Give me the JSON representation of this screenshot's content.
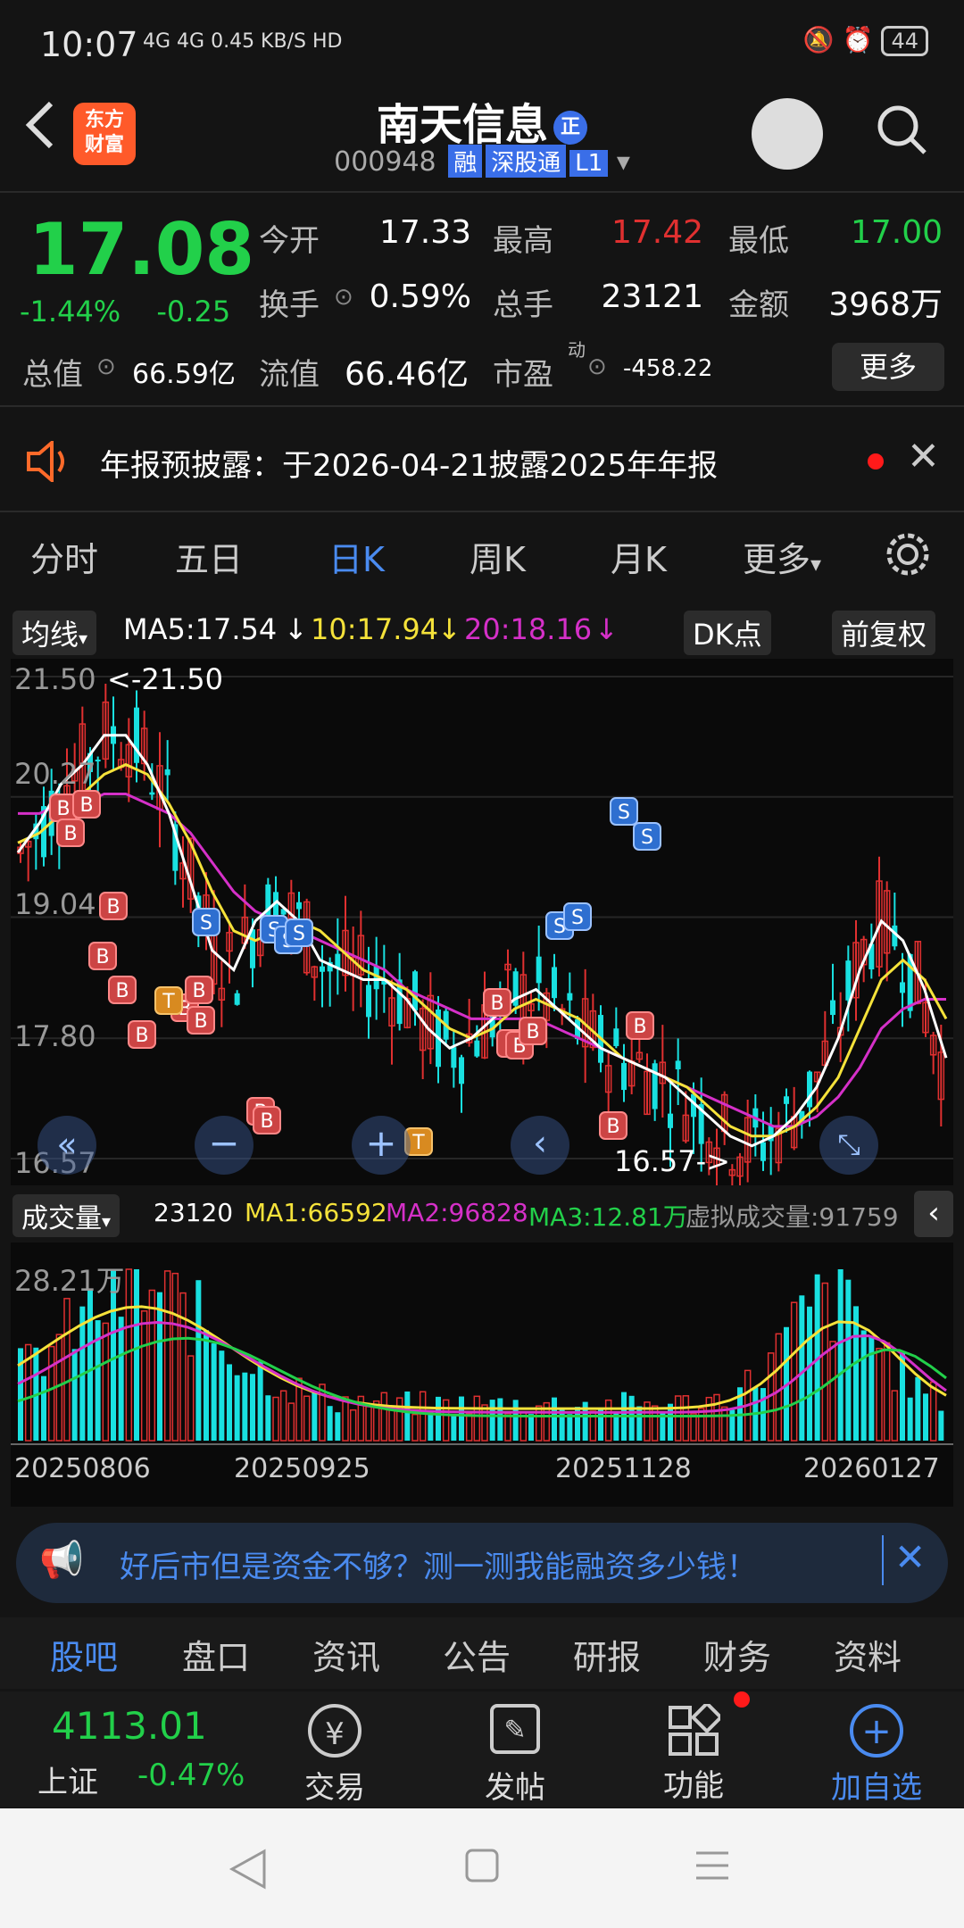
{
  "status": {
    "time": "10:07",
    "network": "4G 4G 0.45 KB/S HD",
    "battery": "44"
  },
  "header": {
    "logo_line1": "东方",
    "logo_line2": "财富",
    "name": "南天信息",
    "badge": "正",
    "code": "000948",
    "tags": [
      "融",
      "深股通",
      "L1"
    ]
  },
  "quote": {
    "price": "17.08",
    "pct": "-1.44%",
    "chg": "-0.25",
    "open_label": "今开",
    "open": "17.33",
    "high_label": "最高",
    "high": "17.42",
    "low_label": "最低",
    "low": "17.00",
    "turnover_label": "换手",
    "turnover": "0.59%",
    "volume_label": "总手",
    "volume": "23121",
    "amount_label": "金额",
    "amount": "3968万",
    "mcap_label": "总值",
    "mcap": "66.59亿",
    "float_label": "流值",
    "float": "66.46亿",
    "pe_label": "市盈",
    "pe_sup": "动",
    "pe": "-458.22",
    "more": "更多"
  },
  "notice": {
    "text": "年报预披露：于2026-04-21披露2025年年报"
  },
  "tabs": [
    "分时",
    "五日",
    "日K",
    "周K",
    "月K",
    "更多"
  ],
  "ma": {
    "selector": "均线",
    "ma5": "MA5:17.54",
    "ma10": "10:17.94",
    "ma20": "20:18.16",
    "dk": "DK点",
    "fq": "前复权"
  },
  "colors": {
    "up": "#e03030",
    "down": "#22d04a",
    "cyan": "#19e0e0",
    "ma5": "#ffffff",
    "ma10": "#f5e23a",
    "ma20": "#d530c8",
    "accent": "#4a8bf0"
  },
  "chart_data": {
    "type": "candlestick",
    "y_ticks": [
      "21.50",
      "20.27",
      "19.04",
      "17.80",
      "16.57"
    ],
    "max_label": "<-21.50",
    "min_label": "16.57->",
    "x_labels": [
      "20250806",
      "20250925",
      "20251128",
      "20260127"
    ],
    "ma5": [
      19.7,
      20.0,
      20.4,
      20.6,
      20.9,
      20.9,
      20.6,
      20.1,
      19.4,
      18.7,
      18.5,
      19.0,
      19.2,
      19.0,
      18.6,
      18.5,
      18.4,
      18.4,
      18.2,
      17.9,
      17.7,
      17.8,
      18.0,
      18.2,
      18.3,
      18.1,
      17.9,
      17.7,
      17.6,
      17.5,
      17.4,
      17.2,
      17.0,
      16.8,
      16.7,
      16.8,
      17.0,
      17.3,
      17.8,
      18.5,
      19.0,
      18.8,
      18.3,
      17.6
    ],
    "ma10": [
      19.8,
      19.9,
      20.1,
      20.3,
      20.5,
      20.6,
      20.5,
      20.2,
      19.8,
      19.3,
      18.9,
      18.8,
      18.9,
      19.0,
      18.9,
      18.7,
      18.5,
      18.4,
      18.3,
      18.1,
      17.9,
      17.8,
      17.9,
      18.1,
      18.2,
      18.1,
      18.0,
      17.8,
      17.6,
      17.5,
      17.4,
      17.3,
      17.1,
      16.9,
      16.8,
      16.8,
      16.9,
      17.1,
      17.4,
      17.9,
      18.4,
      18.6,
      18.4,
      18.0
    ],
    "ma20": [
      20.1,
      20.1,
      20.2,
      20.2,
      20.3,
      20.3,
      20.2,
      20.1,
      19.9,
      19.6,
      19.3,
      19.1,
      19.0,
      18.9,
      18.8,
      18.7,
      18.6,
      18.5,
      18.3,
      18.2,
      18.1,
      18.0,
      18.0,
      18.0,
      18.0,
      17.9,
      17.8,
      17.7,
      17.6,
      17.5,
      17.4,
      17.3,
      17.2,
      17.1,
      17.0,
      16.9,
      16.9,
      17.0,
      17.2,
      17.5,
      17.9,
      18.1,
      18.2,
      18.2
    ]
  },
  "vol": {
    "selector": "成交量",
    "v": "23120",
    "ma1": "MA1:66592",
    "ma2": "MA2:96828",
    "ma3": "MA3:12.81万",
    "virtual": "虚拟成交量:91759",
    "y_label": "28.21万"
  },
  "ad": {
    "text": "好后市但是资金不够？测一测我能融资多少钱！"
  },
  "bottom_tabs": [
    "股吧",
    "盘口",
    "资讯",
    "公告",
    "研报",
    "财务",
    "资料"
  ],
  "footer": {
    "index_value": "4113.01",
    "index_name": "上证",
    "index_pct": "-0.47%",
    "buttons": [
      "交易",
      "发帖",
      "功能",
      "加自选"
    ]
  }
}
